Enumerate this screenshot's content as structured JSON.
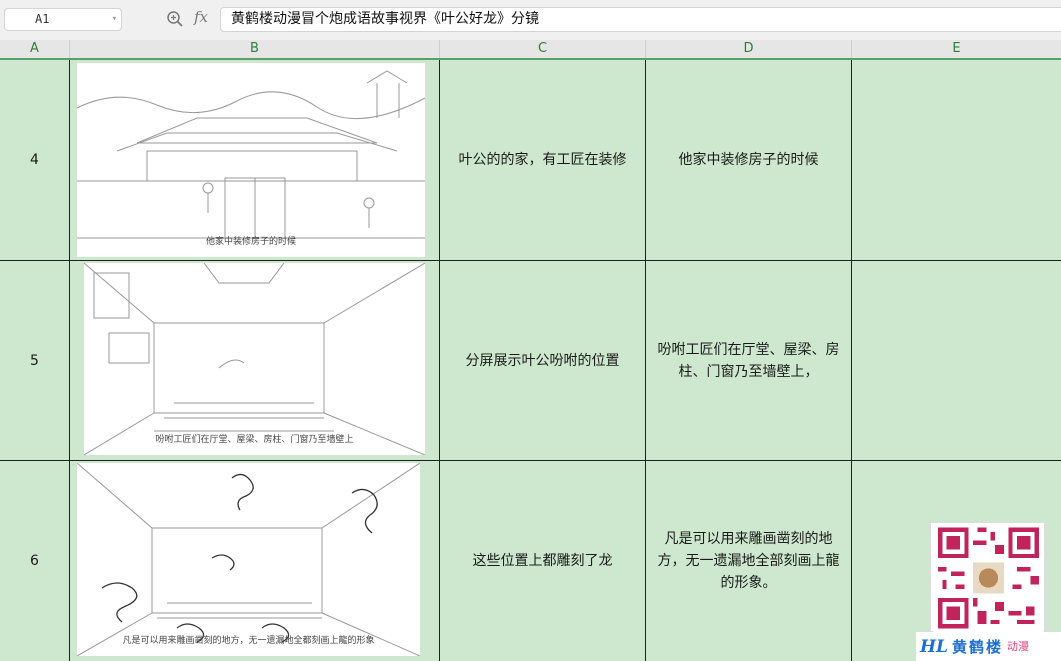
{
  "formula_bar": {
    "name_box": "A1",
    "fx_label": "fx",
    "content": "黄鹤楼动漫冒个炮成语故事视界《叶公好龙》分镜"
  },
  "columns": [
    "A",
    "B",
    "C",
    "D",
    "E"
  ],
  "rows": [
    {
      "number": "4",
      "caption": "他家中装修房子的时候",
      "description": "叶公的的家，有工匠在装修",
      "narration": "他家中装修房子的时候",
      "note": ""
    },
    {
      "number": "5",
      "caption": "吩咐工匠们在厅堂、屋梁、房柱、门窗乃至墙壁上",
      "description": "分屏展示叶公吩咐的位置",
      "narration": "吩咐工匠们在厅堂、屋梁、房柱、门窗乃至墙壁上，",
      "note": ""
    },
    {
      "number": "6",
      "caption": "凡是可以用来雕画凿刻的地方，无一遗漏地全都刻画上龍的形象",
      "description": "这些位置上都雕刻了龙",
      "narration": "凡是可以用来雕画凿刻的地方，无一遗漏地全部刻画上龍的形象。",
      "note": ""
    }
  ],
  "watermark": {
    "brand": "黄鹤楼",
    "tag": "动漫",
    "logo": "HL"
  },
  "colors": {
    "cell_fill": "#cde8cf",
    "header_accent": "#2e7d3e",
    "brand_blue": "#1d6fd3",
    "brand_pink": "#e23f7c"
  }
}
